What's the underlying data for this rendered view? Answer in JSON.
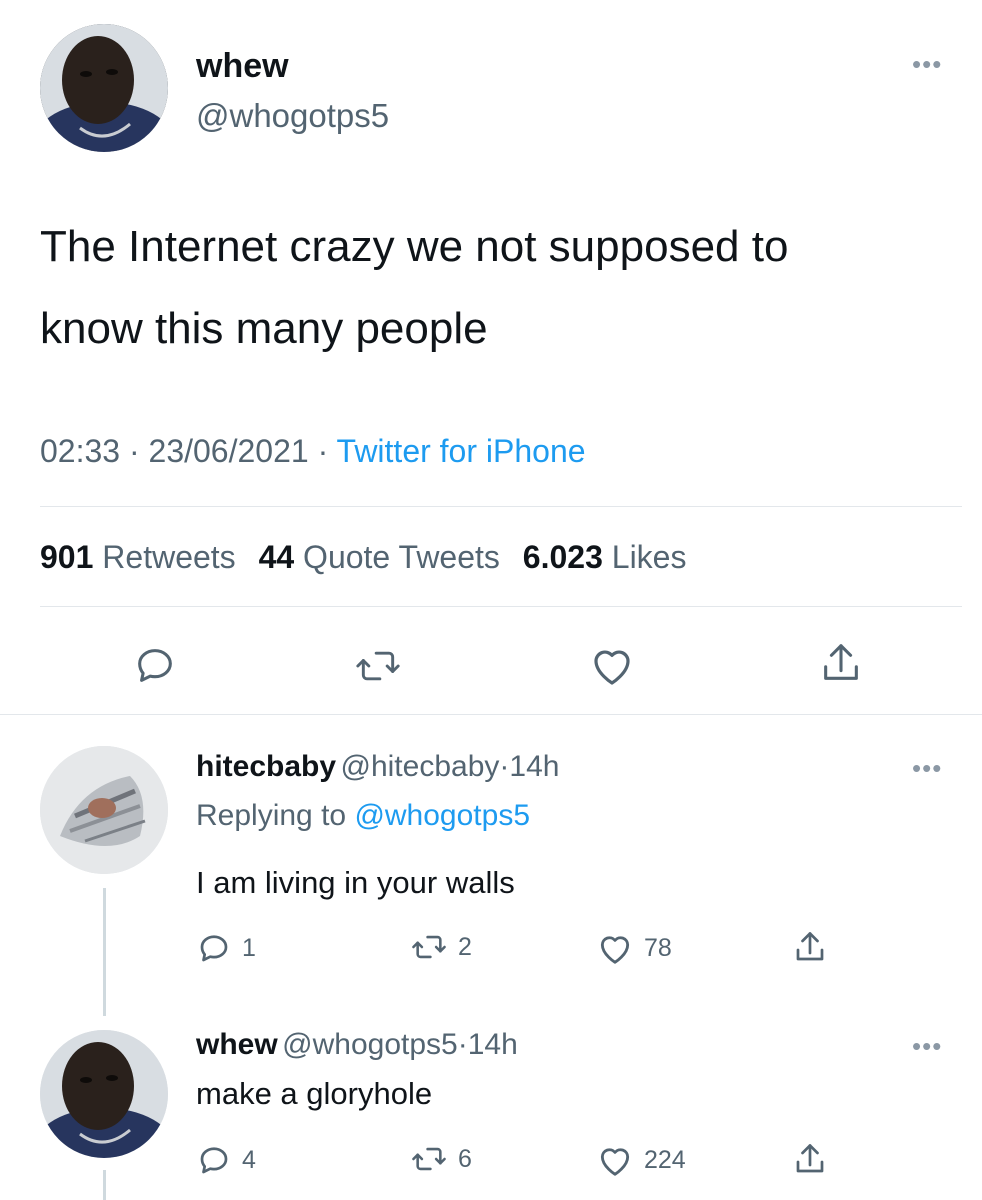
{
  "main_tweet": {
    "author": {
      "display_name": "whew",
      "handle": "@whogotps5"
    },
    "text_line1": "The Internet crazy we not supposed to",
    "text_line2": "know this many people",
    "time": "02:33",
    "date": "23/06/2021",
    "source": "Twitter for iPhone",
    "separator": "·",
    "stats": {
      "retweets_count": "901",
      "retweets_label": "Retweets",
      "quotes_count": "44",
      "quotes_label": "Quote Tweets",
      "likes_count": "6.023",
      "likes_label": "Likes"
    },
    "more_label": "•••"
  },
  "replies": [
    {
      "display_name": "hitecbaby",
      "handle": "@hitecbaby",
      "time": "14h",
      "replying_prefix": "Replying to",
      "replying_to": "@whogotps5",
      "text": "I am living in your walls",
      "reply_count": "1",
      "retweet_count": "2",
      "like_count": "78"
    },
    {
      "display_name": "whew",
      "handle": "@whogotps5",
      "time": "14h",
      "text": "make a gloryhole",
      "reply_count": "4",
      "retweet_count": "6",
      "like_count": "224"
    }
  ],
  "colors": {
    "text": "#0f1419",
    "secondary": "#536471",
    "link": "#1d9bf0",
    "divider": "#e3e7eb"
  },
  "icons": {
    "reply": "comment-bubble-icon",
    "retweet": "retweet-arrows-icon",
    "like": "heart-outline-icon",
    "share": "share-upload-icon",
    "more": "more-dots-icon"
  }
}
